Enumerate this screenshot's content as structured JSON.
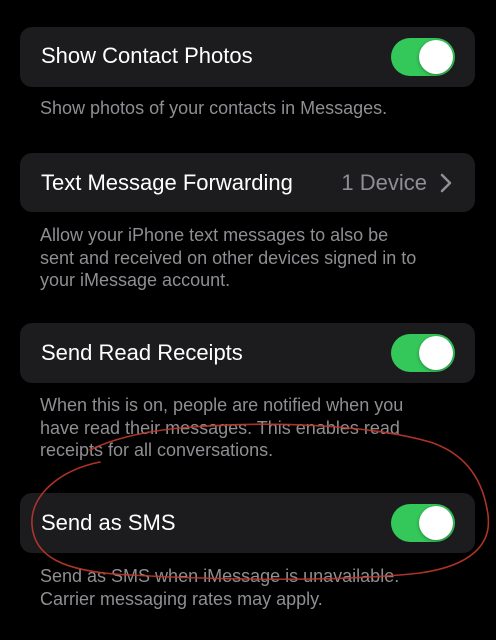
{
  "settings": {
    "show_contact_photos": {
      "label": "Show Contact Photos",
      "enabled": true,
      "footnote": "Show photos of your contacts in Messages."
    },
    "text_message_forwarding": {
      "label": "Text Message Forwarding",
      "value": "1 Device",
      "footnote_lines": [
        "Allow your iPhone text messages to also be",
        "sent and received on other devices signed in to",
        "your iMessage account."
      ]
    },
    "send_read_receipts": {
      "label": "Send Read Receipts",
      "enabled": true,
      "footnote_lines": [
        "When this is on, people are notified when you",
        "have read their messages. This enables read",
        "receipts for all conversations."
      ]
    },
    "send_as_sms": {
      "label": "Send as SMS",
      "enabled": true,
      "footnote_lines": [
        "Send as SMS when iMessage is unavailable.",
        "Carrier messaging rates may apply."
      ]
    }
  },
  "icons": {
    "chevron": "chevron-right-icon"
  },
  "colors": {
    "background": "#000000",
    "cell": "#1c1c1e",
    "toggle_on": "#34c759",
    "secondary_text": "#8e8e93",
    "annotation_ink": "#c0392b"
  }
}
